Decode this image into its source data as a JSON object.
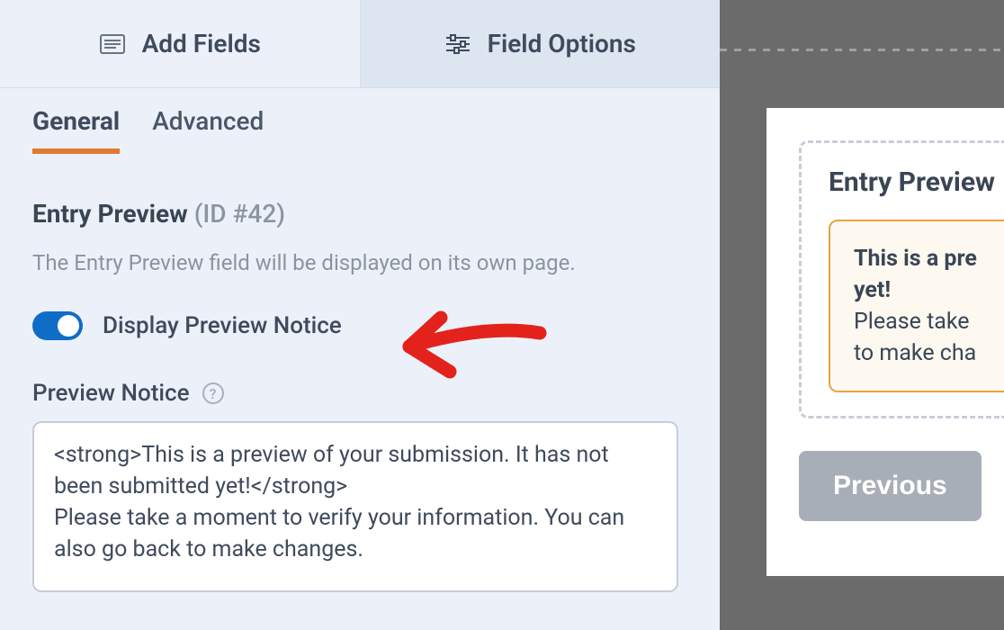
{
  "topTabs": {
    "addFields": "Add Fields",
    "fieldOptions": "Field Options"
  },
  "subTabs": {
    "general": "General",
    "advanced": "Advanced"
  },
  "field": {
    "name": "Entry Preview",
    "id": "(ID #42)",
    "description": "The Entry Preview field will be displayed on its own page.",
    "toggleLabel": "Display Preview Notice",
    "noticeLabel": "Preview Notice",
    "noticeValue": "<strong>This is a preview of your submission. It has not been submitted yet!</strong>\nPlease take a moment to verify your information. You can also go back to make changes."
  },
  "preview": {
    "heading": "Entry Preview",
    "noticeBold1": "This is a pre",
    "noticeBold2": "yet!",
    "noticeLine1": "Please take ",
    "noticeLine2": "to make cha",
    "prevButton": "Previous"
  },
  "helpGlyph": "?"
}
